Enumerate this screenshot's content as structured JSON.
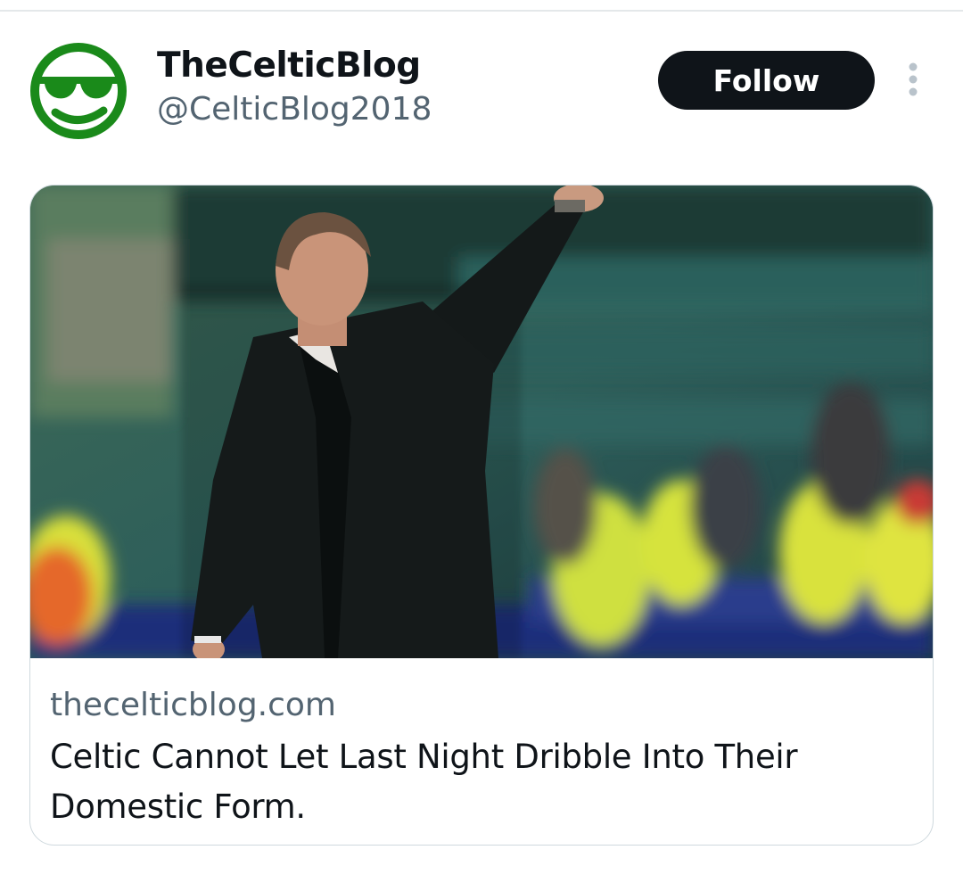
{
  "author": {
    "display_name": "TheCelticBlog",
    "handle": "@CelticBlog2018",
    "avatar_icon": "sunglasses-smiley-icon",
    "avatar_color": "#1a8a1a"
  },
  "actions": {
    "follow_label": "Follow",
    "more_icon": "more-vertical-icon"
  },
  "card": {
    "domain": "thecelticblog.com",
    "title": "Celtic Cannot Let Last Night Dribble Into Their Domestic Form."
  },
  "colors": {
    "follow_bg": "#0f1419",
    "secondary_text": "#536471"
  }
}
